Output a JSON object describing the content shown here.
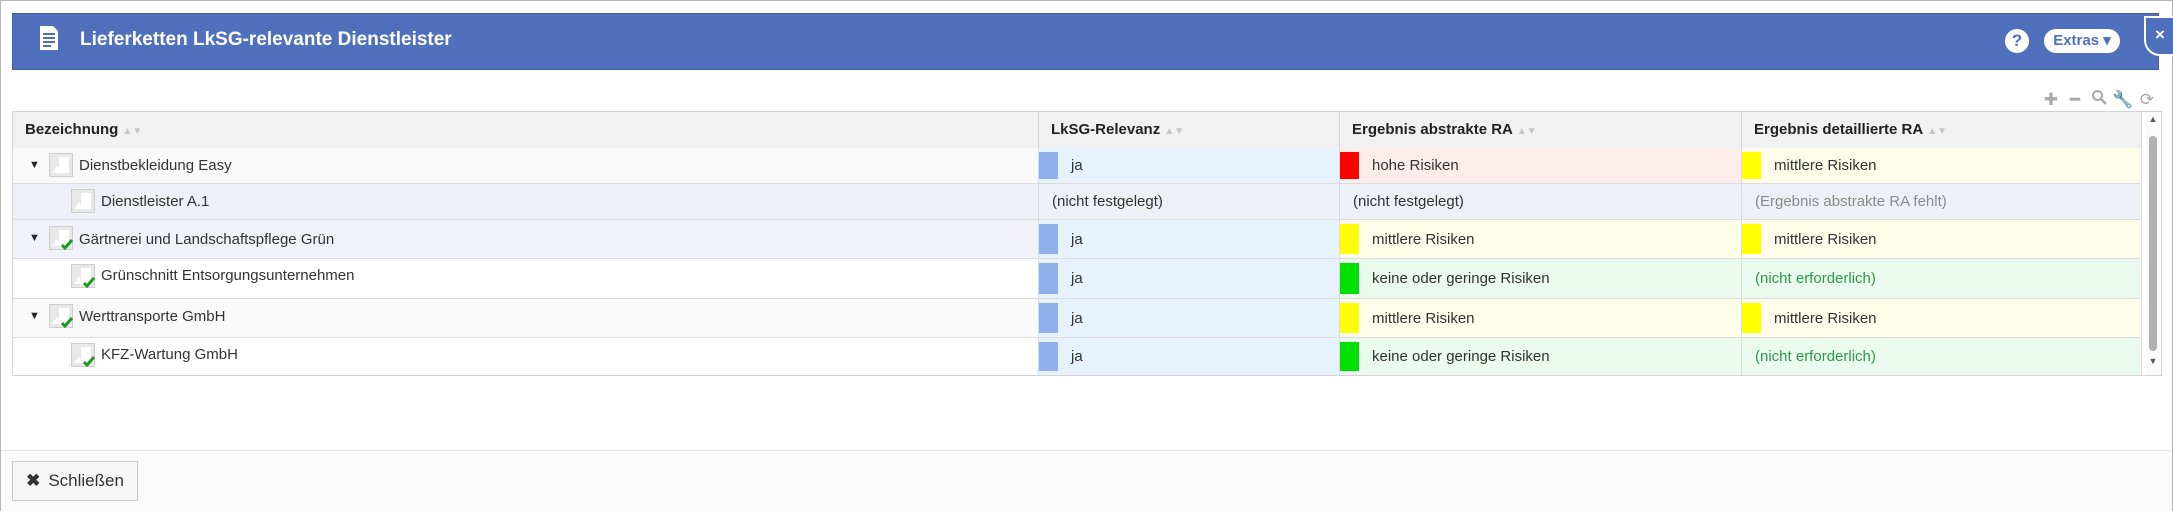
{
  "window": {
    "title": "Lieferketten LkSG-relevante Dienstleister",
    "help_label": "?",
    "extras_label": "Extras",
    "close_label": "×",
    "accent": "#4f71bd"
  },
  "toolbar": {
    "icons": [
      "plus-icon",
      "minus-icon",
      "search-icon",
      "wrench-icon",
      "refresh-icon"
    ]
  },
  "table": {
    "columns": [
      "Bezeichnung",
      "LkSG-Relevanz",
      "Ergebnis abstrakte RA",
      "Ergebnis detaillierte RA"
    ],
    "rows": [
      {
        "name": "Dienstbekleidung Easy",
        "lksg": "ja",
        "abs": "hohe Risiken",
        "det": "mittlere Risiken"
      },
      {
        "name": "Dienstleister A.1",
        "lksg": "(nicht festgelegt)",
        "abs": "(nicht festgelegt)",
        "det": "(Ergebnis abstrakte RA fehlt)"
      },
      {
        "name": "Gärtnerei und Landschaftspflege Grün",
        "lksg": "ja",
        "abs": "mittlere Risiken",
        "det": "mittlere Risiken"
      },
      {
        "name": "Grünschnitt Entsorgungsunternehmen",
        "lksg": "ja",
        "abs": "keine oder geringe Risiken",
        "det": "(nicht erforderlich)"
      },
      {
        "name": "Werttransporte GmbH",
        "lksg": "ja",
        "abs": "mittlere Risiken",
        "det": "mittlere Risiken"
      },
      {
        "name": "KFZ-Wartung GmbH",
        "lksg": "ja",
        "abs": "keine oder geringe Risiken",
        "det": "(nicht erforderlich)"
      }
    ],
    "status_colors": {
      "relevance": "#8fb0ea",
      "high": "#ff0000",
      "medium": "#ffff00",
      "low": "#00e000"
    }
  },
  "footer": {
    "close_button_label": "Schließen"
  }
}
